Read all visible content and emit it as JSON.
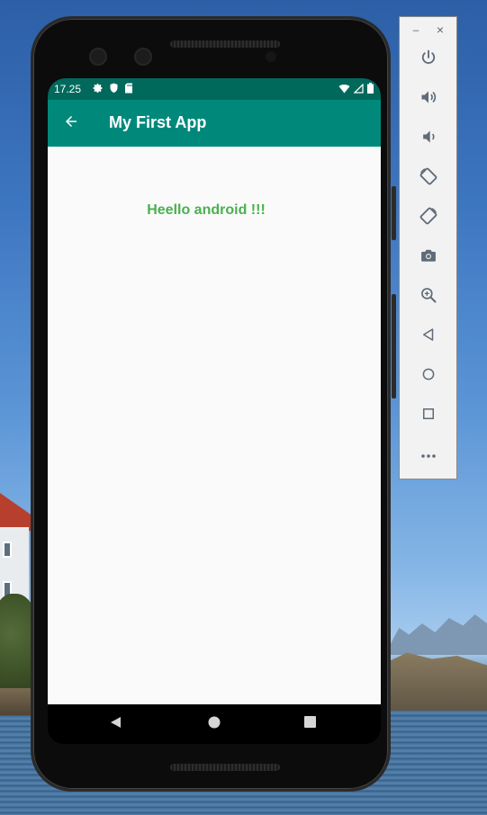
{
  "status_bar": {
    "time": "17.25",
    "icons_left": [
      "gear-icon",
      "shield-icon",
      "sd-card-icon"
    ],
    "icons_right": [
      "wifi-icon",
      "cell-signal-icon",
      "battery-icon"
    ]
  },
  "app_bar": {
    "title": "My First App",
    "back_icon": "arrow-back-icon"
  },
  "content": {
    "message": "Heello android !!!"
  },
  "nav_bar": {
    "buttons": [
      "back-triangle-icon",
      "home-circle-icon",
      "recents-square-icon"
    ]
  },
  "emulator_toolbar": {
    "window_controls": {
      "minimize": "–",
      "close": "×"
    },
    "buttons": [
      "power-icon",
      "volume-up-icon",
      "volume-down-icon",
      "rotate-left-icon",
      "rotate-right-icon",
      "camera-icon",
      "zoom-icon",
      "back-icon",
      "home-icon",
      "overview-icon",
      "more-icon"
    ]
  },
  "colors": {
    "status_bar": "#00695c",
    "app_bar": "#00897b",
    "message_text": "#4caf50",
    "screen_background": "#fafafa",
    "toolbar_icon": "#5f6b78"
  }
}
